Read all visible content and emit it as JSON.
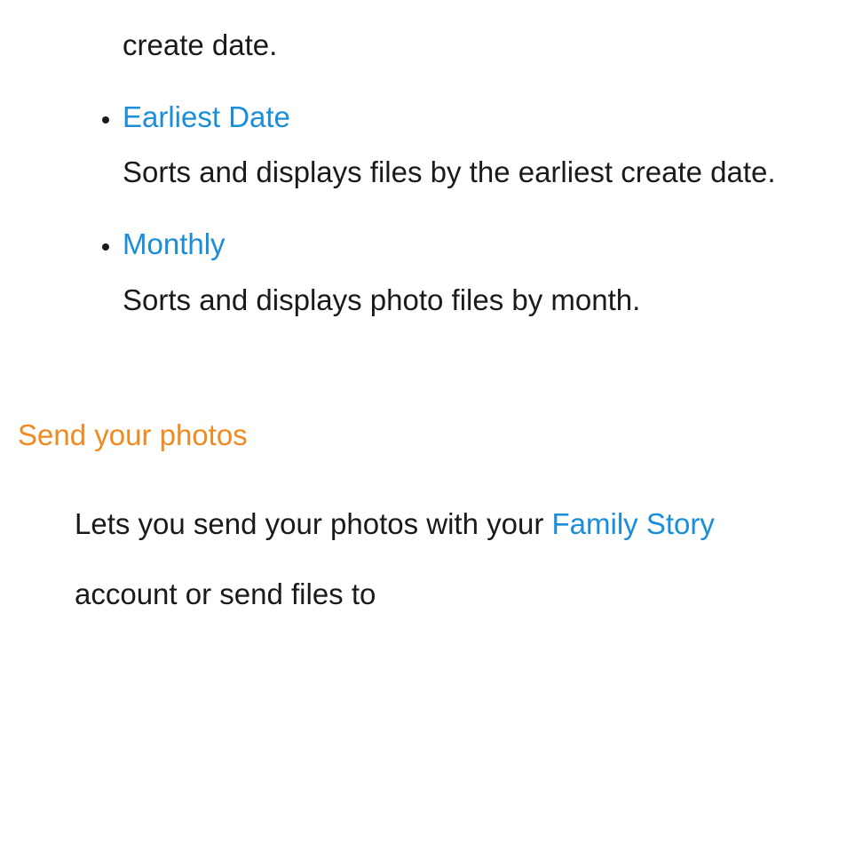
{
  "frag_top": "create date.",
  "bullets": [
    {
      "title": "Earliest Date",
      "desc": "Sorts and displays files by the earliest create date."
    },
    {
      "title": "Monthly",
      "desc": "Sorts and displays photo files by month."
    }
  ],
  "section": {
    "heading": "Send your photos",
    "body_before": "Lets you send your photos with your ",
    "body_link": "Family Story",
    "body_after": " account or send files to"
  }
}
